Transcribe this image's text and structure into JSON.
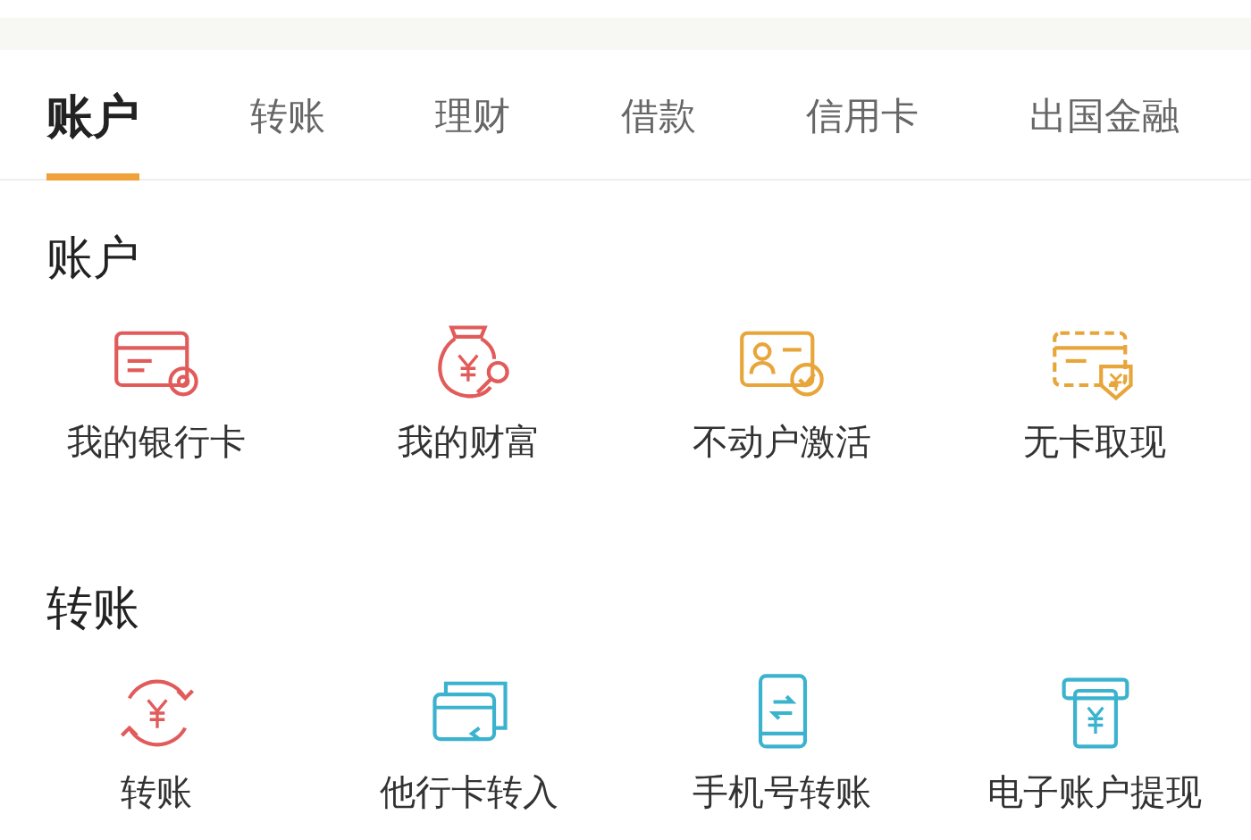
{
  "tabs": [
    {
      "label": "账户",
      "selected": true
    },
    {
      "label": "转账",
      "selected": false
    },
    {
      "label": "理财",
      "selected": false
    },
    {
      "label": "借款",
      "selected": false
    },
    {
      "label": "信用卡",
      "selected": false
    },
    {
      "label": "出国金融",
      "selected": false
    }
  ],
  "sections": [
    {
      "title": "账户",
      "items": [
        {
          "label": "我的银行卡",
          "kind": "card-gear",
          "color": "#e25b5b"
        },
        {
          "label": "我的财富",
          "kind": "money-bag",
          "color": "#e25b5b"
        },
        {
          "label": "不动户激活",
          "kind": "id-check",
          "color": "#e8a53a"
        },
        {
          "label": "无卡取现",
          "kind": "card-cash",
          "color": "#e8a53a"
        }
      ]
    },
    {
      "title": "转账",
      "items": [
        {
          "label": "转账",
          "kind": "yuan-cycle",
          "color": "#e25b5b"
        },
        {
          "label": "他行卡转入",
          "kind": "cards",
          "color": "#3bb3cf"
        },
        {
          "label": "手机号转账",
          "kind": "phone",
          "color": "#3bb3cf"
        },
        {
          "label": "电子账户提现",
          "kind": "atm",
          "color": "#3bb3cf"
        }
      ]
    }
  ]
}
